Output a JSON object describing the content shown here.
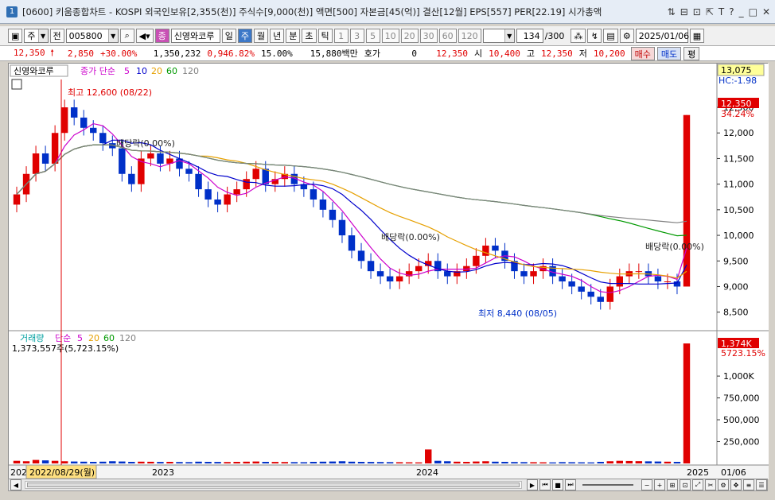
{
  "window": {
    "num": "1",
    "title": "[0600] 키움종합차트 - KOSPI 외국인보유[2,355(천)] 주식수[9,000(천)] 액면[500] 자본금[45(억)] 결산[12월] EPS[557] PER[22.19] 시가총액",
    "controls": [
      "⇅",
      "⊟",
      "⊡",
      "⇱",
      "T",
      "?",
      "_",
      "□",
      "✕"
    ]
  },
  "toolbar": {
    "period_select": "주",
    "prev_label": "전",
    "code": "005800",
    "name": "신영와코루",
    "tabs": [
      {
        "label": "일",
        "active": false
      },
      {
        "label": "주",
        "active": true
      },
      {
        "label": "월",
        "active": false
      },
      {
        "label": "년",
        "active": false
      },
      {
        "label": "분",
        "active": false
      },
      {
        "label": "초",
        "active": false
      },
      {
        "label": "틱",
        "active": false
      }
    ],
    "intervals": [
      "1",
      "3",
      "5",
      "10",
      "20",
      "30",
      "60",
      "120"
    ],
    "count": "134",
    "count_total": "/300",
    "date": "2025/01/06",
    "jong_label": "종"
  },
  "quote": {
    "price": "12,350",
    "change": "2,850",
    "change_pct": "+30.00%",
    "volume": "1,350,232",
    "vol_ratio": "0,946.82%",
    "turnover": "15.00%",
    "amount": "15,880백만",
    "hoga_label": "호가",
    "hoga": "0",
    "price2": "12,350",
    "open_label": "시",
    "open": "10,400",
    "high_label": "고",
    "high": "12,350",
    "low_label": "저",
    "low": "10,200",
    "buy": "매수",
    "sell": "매도",
    "avg": "평"
  },
  "price_panel": {
    "legend_name": "신영와코루",
    "legend_ma": "종가 단순",
    "ma_periods": [
      "5",
      "10",
      "20",
      "60",
      "120"
    ],
    "ma_colors": [
      "#cc00cc",
      "#0000cc",
      "#e6a000",
      "#009900",
      "#808080"
    ],
    "top_label": "13,075",
    "hc_label": "HC:-1.98",
    "last_price_tag": "12,350",
    "last_pct_tag": "34.24%",
    "high_note": "최고 12,600 (08/22)",
    "low_note": "최저 8,440 (08/05)",
    "div_notes": [
      "배당락(0.00%)",
      "배당락(0.00%)",
      "배당락(0.00%)"
    ]
  },
  "volume_panel": {
    "legend": "거래량",
    "legend_ma": "단순",
    "ma_periods": [
      "5",
      "20",
      "60",
      "120"
    ],
    "value": "1,373,557주(5,723.15%)",
    "tag_value": "1,374K",
    "tag_pct": "5723.15%"
  },
  "x_axis": {
    "labels": [
      "2022",
      "2023",
      "2024",
      "2025",
      "01/06"
    ],
    "cursor_date": "2022/08/29(월)"
  },
  "chart_data": {
    "type": "candlestick",
    "y_price_ticks": [
      12500,
      12000,
      11500,
      11000,
      10500,
      10000,
      9500,
      9000,
      8500
    ],
    "y_price_range": [
      8200,
      13075
    ],
    "y_volume_ticks": [
      "1,000K",
      "750,000",
      "500,000",
      "250,000"
    ],
    "y_volume_range": [
      0,
      1374000
    ],
    "last_close": 12350,
    "high": 12600,
    "low": 8440,
    "closes": [
      10800,
      11200,
      11600,
      11400,
      12000,
      12500,
      12300,
      12100,
      12000,
      11800,
      11700,
      11200,
      11000,
      11500,
      11600,
      11400,
      11500,
      11300,
      11200,
      10900,
      10700,
      10600,
      10800,
      10900,
      11100,
      11300,
      11000,
      11100,
      11200,
      11000,
      10900,
      10700,
      10500,
      10300,
      10000,
      9700,
      9500,
      9300,
      9200,
      9100,
      9200,
      9300,
      9400,
      9500,
      9300,
      9200,
      9300,
      9400,
      9600,
      9800,
      9700,
      9500,
      9300,
      9200,
      9300,
      9400,
      9200,
      9100,
      9000,
      8900,
      8800,
      8700,
      9000,
      9200,
      9300,
      9300,
      9200,
      9100,
      9100,
      9000,
      12350
    ],
    "volumes": [
      30000,
      25000,
      40000,
      35000,
      30000,
      25000,
      22000,
      20000,
      18000,
      20000,
      25000,
      22000,
      18000,
      20000,
      19000,
      17000,
      18000,
      16000,
      15000,
      20000,
      18000,
      17000,
      16000,
      18000,
      20000,
      22000,
      18000,
      17000,
      16000,
      15000,
      14000,
      18000,
      20000,
      22000,
      25000,
      20000,
      18000,
      17000,
      16000,
      15000,
      14000,
      13000,
      12000,
      160000,
      30000,
      25000,
      20000,
      18000,
      22000,
      25000,
      20000,
      18000,
      16000,
      15000,
      14000,
      13000,
      12000,
      15000,
      14000,
      13000,
      12000,
      18000,
      25000,
      30000,
      28000,
      26000,
      24000,
      22000,
      20000,
      18000,
      1373557
    ]
  }
}
